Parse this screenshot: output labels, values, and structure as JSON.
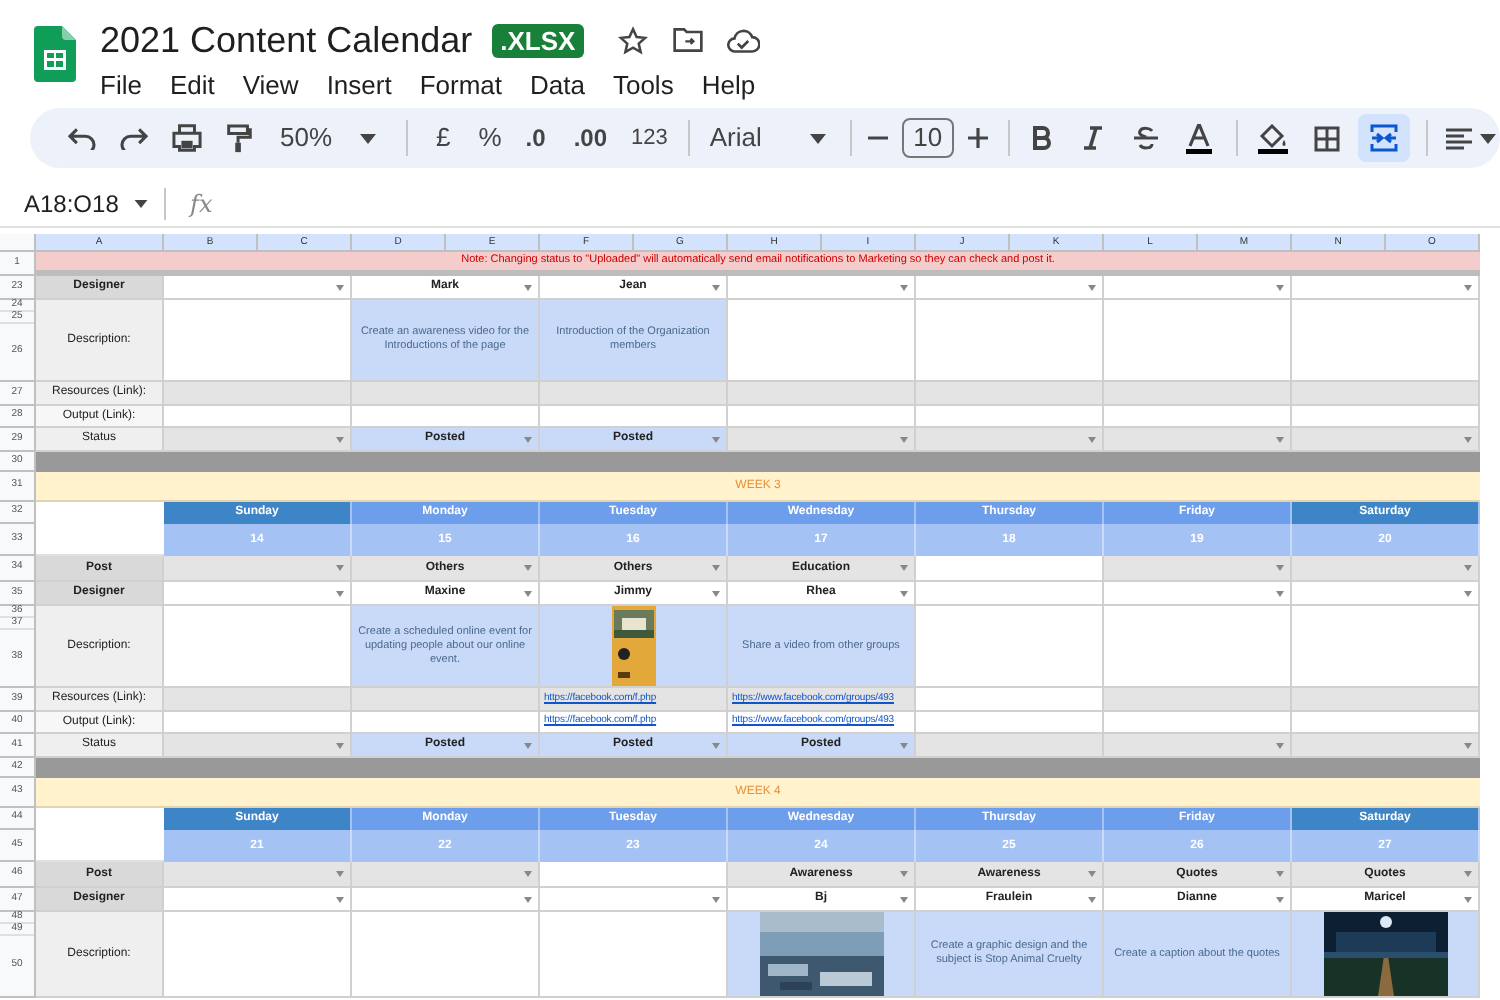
{
  "title": "2021 Content Calendar",
  "badge": ".XLSX",
  "menus": [
    "File",
    "Edit",
    "View",
    "Insert",
    "Format",
    "Data",
    "Tools",
    "Help"
  ],
  "toolbar": {
    "zoom": "50%",
    "currency": "£",
    "percent": "%",
    "decrease_decimals": ".0",
    "increase_decimals": ".00",
    "number_format": "123",
    "font": "Arial",
    "font_size": "10",
    "merge_selected": true
  },
  "name_box": "A18:O18",
  "fx": "fx",
  "columns": [
    "A",
    "B",
    "C",
    "D",
    "E",
    "F",
    "G",
    "H",
    "I",
    "J",
    "K",
    "L",
    "M",
    "N",
    "O"
  ],
  "rows": [
    {
      "kind": "notice",
      "numbers": [
        "1"
      ],
      "text": "Note: Changing status to \"Uploaded\" will automatically send email notifications to Marketing so they can check and post it."
    },
    {
      "kind": "designer",
      "numbers": [
        "23"
      ],
      "label": "Designer",
      "cells": [
        {
          "kind": "text",
          "highlighted": false,
          "shaded": false,
          "dropdown": true
        },
        {
          "kind": "text",
          "text": "Mark",
          "highlighted": false,
          "shaded": false,
          "dropdown": true
        },
        {
          "kind": "text",
          "text": "Jean",
          "highlighted": false,
          "shaded": false,
          "dropdown": true
        },
        {
          "kind": "text",
          "highlighted": false,
          "shaded": false,
          "dropdown": true
        },
        {
          "kind": "text",
          "highlighted": false,
          "shaded": false,
          "dropdown": true
        },
        {
          "kind": "text",
          "highlighted": false,
          "shaded": false,
          "dropdown": true
        },
        {
          "kind": "text",
          "highlighted": false,
          "shaded": false,
          "dropdown": true
        }
      ]
    },
    {
      "kind": "description",
      "numbers": [
        "24",
        "25",
        "26"
      ],
      "label": "Description:",
      "cells": [
        {
          "kind": "text",
          "highlighted": false,
          "shaded": false,
          "dropdown": false
        },
        {
          "kind": "text",
          "text": "Create an awareness video for the Introductions of the page",
          "highlighted": true,
          "shaded": false,
          "dropdown": false
        },
        {
          "kind": "text",
          "text": "Introduction of  the Organization members",
          "highlighted": true,
          "shaded": false,
          "dropdown": false
        },
        {
          "kind": "text",
          "highlighted": false,
          "shaded": false,
          "dropdown": false
        },
        {
          "kind": "text",
          "highlighted": false,
          "shaded": false,
          "dropdown": false
        },
        {
          "kind": "text",
          "highlighted": false,
          "shaded": false,
          "dropdown": false
        },
        {
          "kind": "text",
          "highlighted": false,
          "shaded": false,
          "dropdown": false
        }
      ]
    },
    {
      "kind": "resources",
      "numbers": [
        "27"
      ],
      "label": "Resources (Link):",
      "cells": [
        {
          "kind": "text",
          "highlighted": false,
          "shaded": true,
          "dropdown": false
        },
        {
          "kind": "text",
          "highlighted": false,
          "shaded": true,
          "dropdown": false
        },
        {
          "kind": "text",
          "highlighted": false,
          "shaded": true,
          "dropdown": false
        },
        {
          "kind": "text",
          "highlighted": false,
          "shaded": true,
          "dropdown": false
        },
        {
          "kind": "text",
          "highlighted": false,
          "shaded": true,
          "dropdown": false
        },
        {
          "kind": "text",
          "highlighted": false,
          "shaded": true,
          "dropdown": false
        },
        {
          "kind": "text",
          "highlighted": false,
          "shaded": true,
          "dropdown": false
        }
      ]
    },
    {
      "kind": "output",
      "numbers": [
        "28"
      ],
      "label": "Output (Link):",
      "cells": [
        {
          "kind": "text",
          "highlighted": false,
          "shaded": false,
          "dropdown": false
        },
        {
          "kind": "text",
          "highlighted": false,
          "shaded": false,
          "dropdown": false
        },
        {
          "kind": "text",
          "highlighted": false,
          "shaded": false,
          "dropdown": false
        },
        {
          "kind": "text",
          "highlighted": false,
          "shaded": false,
          "dropdown": false
        },
        {
          "kind": "text",
          "highlighted": false,
          "shaded": false,
          "dropdown": false
        },
        {
          "kind": "text",
          "highlighted": false,
          "shaded": false,
          "dropdown": false
        },
        {
          "kind": "text",
          "highlighted": false,
          "shaded": false,
          "dropdown": false
        }
      ]
    },
    {
      "kind": "status",
      "numbers": [
        "29"
      ],
      "label": "Status",
      "cells": [
        {
          "kind": "text",
          "highlighted": false,
          "shaded": true,
          "dropdown": true
        },
        {
          "kind": "text",
          "text": "Posted",
          "highlighted": true,
          "shaded": false,
          "dropdown": true
        },
        {
          "kind": "text",
          "text": "Posted",
          "highlighted": true,
          "shaded": false,
          "dropdown": true
        },
        {
          "kind": "text",
          "highlighted": false,
          "shaded": true,
          "dropdown": true
        },
        {
          "kind": "text",
          "highlighted": false,
          "shaded": true,
          "dropdown": true
        },
        {
          "kind": "text",
          "highlighted": false,
          "shaded": true,
          "dropdown": true
        },
        {
          "kind": "text",
          "highlighted": false,
          "shaded": true,
          "dropdown": true
        }
      ]
    },
    {
      "kind": "band",
      "numbers": [
        "30"
      ]
    },
    {
      "kind": "week",
      "numbers": [
        "31"
      ],
      "label": "WEEK 3"
    },
    {
      "kind": "days",
      "numbers": [
        "32"
      ],
      "days": [
        {
          "name": "Sunday",
          "weekend": true
        },
        {
          "name": "Monday",
          "weekend": false
        },
        {
          "name": "Tuesday",
          "weekend": false
        },
        {
          "name": "Wednesday",
          "weekend": false
        },
        {
          "name": "Thursday",
          "weekend": false
        },
        {
          "name": "Friday",
          "weekend": false
        },
        {
          "name": "Saturday",
          "weekend": true
        }
      ]
    },
    {
      "kind": "dates",
      "numbers": [
        "33"
      ],
      "dates": [
        "14",
        "15",
        "16",
        "17",
        "18",
        "19",
        "20"
      ]
    },
    {
      "kind": "post",
      "numbers": [
        "34"
      ],
      "label": "Post",
      "cells": [
        {
          "kind": "text",
          "highlighted": false,
          "shaded": true,
          "dropdown": true
        },
        {
          "kind": "text",
          "text": "Others",
          "highlighted": false,
          "shaded": true,
          "dropdown": true
        },
        {
          "kind": "text",
          "text": "Others",
          "highlighted": false,
          "shaded": true,
          "dropdown": true
        },
        {
          "kind": "text",
          "text": "Education",
          "highlighted": false,
          "shaded": true,
          "dropdown": true
        },
        {
          "kind": "text",
          "highlighted": false,
          "shaded": false,
          "dropdown": false
        },
        {
          "kind": "text",
          "highlighted": false,
          "shaded": true,
          "dropdown": true
        },
        {
          "kind": "text",
          "highlighted": false,
          "shaded": true,
          "dropdown": true
        }
      ]
    },
    {
      "kind": "designer",
      "numbers": [
        "35"
      ],
      "label": "Designer",
      "cells": [
        {
          "kind": "text",
          "highlighted": false,
          "shaded": false,
          "dropdown": true
        },
        {
          "kind": "text",
          "text": "Maxine",
          "highlighted": false,
          "shaded": false,
          "dropdown": true
        },
        {
          "kind": "text",
          "text": "Jimmy",
          "highlighted": false,
          "shaded": false,
          "dropdown": true
        },
        {
          "kind": "text",
          "text": "Rhea",
          "highlighted": false,
          "shaded": false,
          "dropdown": true
        },
        {
          "kind": "text",
          "highlighted": false,
          "shaded": false,
          "dropdown": false
        },
        {
          "kind": "text",
          "highlighted": false,
          "shaded": false,
          "dropdown": true
        },
        {
          "kind": "text",
          "highlighted": false,
          "shaded": false,
          "dropdown": true
        }
      ]
    },
    {
      "kind": "description",
      "numbers": [
        "36",
        "37",
        "38"
      ],
      "label": "Description:",
      "cells": [
        {
          "kind": "text",
          "highlighted": false,
          "shaded": false,
          "dropdown": false
        },
        {
          "kind": "text",
          "text": "Create a scheduled online event for updating people about our online event.",
          "highlighted": true,
          "shaded": false,
          "dropdown": false
        },
        {
          "kind": "picture",
          "highlighted": true,
          "shaded": false,
          "dropdown": false
        },
        {
          "kind": "text",
          "text": "Share a video from other groups",
          "highlighted": true,
          "shaded": false,
          "dropdown": false
        },
        {
          "kind": "text",
          "highlighted": false,
          "shaded": false,
          "dropdown": false
        },
        {
          "kind": "text",
          "highlighted": false,
          "shaded": false,
          "dropdown": false
        },
        {
          "kind": "text",
          "highlighted": false,
          "shaded": false,
          "dropdown": false
        }
      ]
    },
    {
      "kind": "resources",
      "numbers": [
        "39"
      ],
      "label": "Resources (Link):",
      "cells": [
        {
          "kind": "text",
          "highlighted": false,
          "shaded": true,
          "dropdown": false
        },
        {
          "kind": "text",
          "highlighted": false,
          "shaded": true,
          "dropdown": false
        },
        {
          "kind": "link",
          "text": "https://facebook.com/f.php",
          "highlighted": false,
          "shaded": true,
          "dropdown": false
        },
        {
          "kind": "link",
          "text": "https://www.facebook.com/groups/493",
          "highlighted": false,
          "shaded": true,
          "dropdown": false
        },
        {
          "kind": "text",
          "highlighted": false,
          "shaded": false,
          "dropdown": false
        },
        {
          "kind": "text",
          "highlighted": false,
          "shaded": true,
          "dropdown": false
        },
        {
          "kind": "text",
          "highlighted": false,
          "shaded": true,
          "dropdown": false
        }
      ]
    },
    {
      "kind": "output",
      "numbers": [
        "40"
      ],
      "label": "Output (Link):",
      "cells": [
        {
          "kind": "text",
          "highlighted": false,
          "shaded": false,
          "dropdown": false
        },
        {
          "kind": "text",
          "highlighted": false,
          "shaded": false,
          "dropdown": false
        },
        {
          "kind": "link",
          "text": "https://facebook.com/f.php",
          "highlighted": false,
          "shaded": false,
          "dropdown": false
        },
        {
          "kind": "link",
          "text": "https://www.facebook.com/groups/493",
          "highlighted": false,
          "shaded": false,
          "dropdown": false
        },
        {
          "kind": "text",
          "highlighted": false,
          "shaded": false,
          "dropdown": false
        },
        {
          "kind": "text",
          "highlighted": false,
          "shaded": false,
          "dropdown": false
        },
        {
          "kind": "text",
          "highlighted": false,
          "shaded": false,
          "dropdown": false
        }
      ]
    },
    {
      "kind": "status",
      "numbers": [
        "41"
      ],
      "label": "Status",
      "cells": [
        {
          "kind": "text",
          "highlighted": false,
          "shaded": true,
          "dropdown": true
        },
        {
          "kind": "text",
          "text": "Posted",
          "highlighted": true,
          "shaded": false,
          "dropdown": true
        },
        {
          "kind": "text",
          "text": "Posted",
          "highlighted": true,
          "shaded": false,
          "dropdown": true
        },
        {
          "kind": "text",
          "text": "Posted",
          "highlighted": true,
          "shaded": false,
          "dropdown": true
        },
        {
          "kind": "text",
          "highlighted": false,
          "shaded": true,
          "dropdown": false
        },
        {
          "kind": "text",
          "highlighted": false,
          "shaded": true,
          "dropdown": true
        },
        {
          "kind": "text",
          "highlighted": false,
          "shaded": true,
          "dropdown": true
        }
      ]
    },
    {
      "kind": "band",
      "numbers": [
        "42"
      ]
    },
    {
      "kind": "week",
      "numbers": [
        "43"
      ],
      "label": "WEEK 4"
    },
    {
      "kind": "days",
      "numbers": [
        "44"
      ],
      "days": [
        {
          "name": "Sunday",
          "weekend": true
        },
        {
          "name": "Monday",
          "weekend": false
        },
        {
          "name": "Tuesday",
          "weekend": false
        },
        {
          "name": "Wednesday",
          "weekend": false
        },
        {
          "name": "Thursday",
          "weekend": false
        },
        {
          "name": "Friday",
          "weekend": false
        },
        {
          "name": "Saturday",
          "weekend": true
        }
      ]
    },
    {
      "kind": "dates",
      "numbers": [
        "45"
      ],
      "dates": [
        "21",
        "22",
        "23",
        "24",
        "25",
        "26",
        "27"
      ]
    },
    {
      "kind": "post",
      "numbers": [
        "46"
      ],
      "label": "Post",
      "cells": [
        {
          "kind": "text",
          "highlighted": false,
          "shaded": true,
          "dropdown": true
        },
        {
          "kind": "text",
          "highlighted": false,
          "shaded": true,
          "dropdown": true
        },
        {
          "kind": "text",
          "highlighted": false,
          "shaded": false,
          "dropdown": false
        },
        {
          "kind": "text",
          "text": "Awareness",
          "highlighted": false,
          "shaded": true,
          "dropdown": true
        },
        {
          "kind": "text",
          "text": "Awareness",
          "highlighted": false,
          "shaded": true,
          "dropdown": true
        },
        {
          "kind": "text",
          "text": "Quotes",
          "highlighted": false,
          "shaded": true,
          "dropdown": true
        },
        {
          "kind": "text",
          "text": "Quotes",
          "highlighted": false,
          "shaded": true,
          "dropdown": true
        }
      ]
    },
    {
      "kind": "designer",
      "numbers": [
        "47"
      ],
      "label": "Designer",
      "cells": [
        {
          "kind": "text",
          "highlighted": false,
          "shaded": false,
          "dropdown": true
        },
        {
          "kind": "text",
          "highlighted": false,
          "shaded": false,
          "dropdown": true
        },
        {
          "kind": "text",
          "highlighted": false,
          "shaded": false,
          "dropdown": true
        },
        {
          "kind": "text",
          "text": "Bj",
          "highlighted": false,
          "shaded": false,
          "dropdown": true
        },
        {
          "kind": "text",
          "text": "Fraulein",
          "highlighted": false,
          "shaded": false,
          "dropdown": true
        },
        {
          "kind": "text",
          "text": "Dianne",
          "highlighted": false,
          "shaded": false,
          "dropdown": true
        },
        {
          "kind": "text",
          "text": "Maricel",
          "highlighted": false,
          "shaded": false,
          "dropdown": true
        }
      ]
    },
    {
      "kind": "description",
      "numbers": [
        "48",
        "49",
        "50"
      ],
      "label": "Description:",
      "cells": [
        {
          "kind": "text",
          "highlighted": false,
          "shaded": false,
          "dropdown": false
        },
        {
          "kind": "text",
          "highlighted": false,
          "shaded": false,
          "dropdown": false
        },
        {
          "kind": "text",
          "highlighted": false,
          "shaded": false,
          "dropdown": false
        },
        {
          "kind": "picture",
          "highlighted": true,
          "shaded": false,
          "dropdown": false
        },
        {
          "kind": "text",
          "text": "Create a graphic design and the subject is Stop Animal Cruelty",
          "highlighted": true,
          "shaded": false,
          "dropdown": false
        },
        {
          "kind": "text",
          "text": "Create a caption about the quotes",
          "highlighted": true,
          "shaded": false,
          "dropdown": false
        },
        {
          "kind": "picture",
          "highlighted": true,
          "shaded": false,
          "dropdown": false
        }
      ]
    }
  ]
}
